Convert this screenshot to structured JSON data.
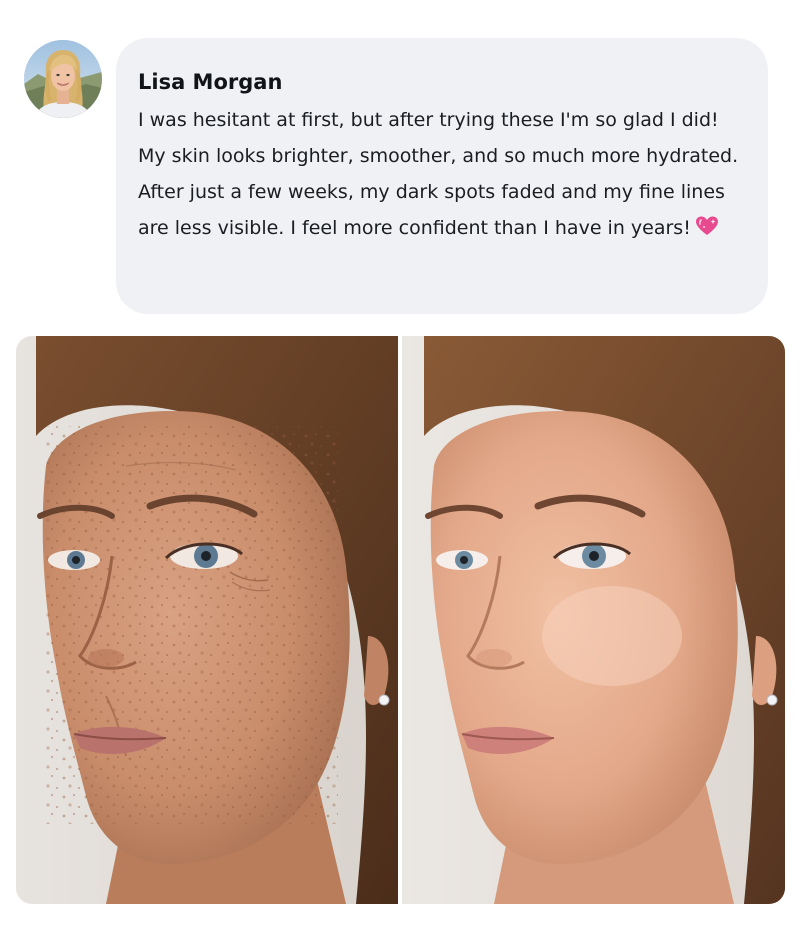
{
  "comment": {
    "author": "Lisa Morgan",
    "text": "I was hesitant at first, but after trying these I'm so glad I did! My skin looks brighter, smoother, and so much more hydrated. After just a few weeks, my dark spots faded and my fine lines are less visible. I feel more confident than I have in years!",
    "emoji": "sparkling-heart-icon"
  },
  "photos": [
    {
      "name": "before-photo",
      "skin_tone": "#c98d6b",
      "freckles": true
    },
    {
      "name": "after-photo",
      "skin_tone": "#e3a889",
      "freckles": false
    }
  ],
  "colors": {
    "bubble_background": "#f0f1f5",
    "text": "#1a1d22",
    "emoji": "#e84a8f"
  }
}
